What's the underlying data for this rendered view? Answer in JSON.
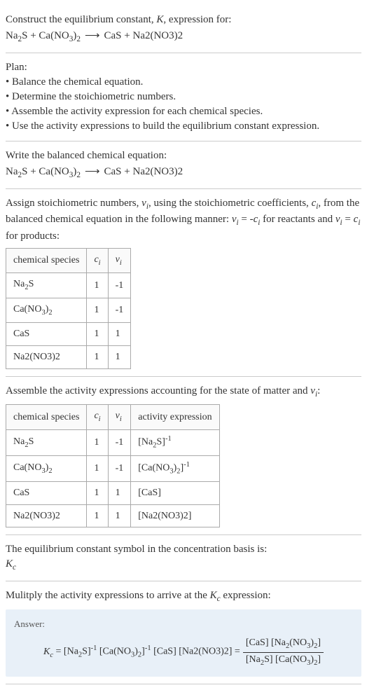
{
  "intro": {
    "line1": "Construct the equilibrium constant, K, expression for:",
    "equation": "Na₂S + Ca(NO₃)₂ ⟶ CaS + Na2(NO3)2"
  },
  "plan": {
    "heading": "Plan:",
    "items": [
      "Balance the chemical equation.",
      "Determine the stoichiometric numbers.",
      "Assemble the activity expression for each chemical species.",
      "Use the activity expressions to build the equilibrium constant expression."
    ]
  },
  "balanced": {
    "heading": "Write the balanced chemical equation:",
    "equation": "Na₂S + Ca(NO₃)₂ ⟶ CaS + Na2(NO3)2"
  },
  "stoich": {
    "text1": "Assign stoichiometric numbers, νᵢ, using the stoichiometric coefficients, cᵢ, from the balanced chemical equation in the following manner: νᵢ = -cᵢ for reactants and νᵢ = cᵢ for products:",
    "headers": [
      "chemical species",
      "cᵢ",
      "νᵢ"
    ],
    "rows": [
      {
        "species": "Na₂S",
        "c": "1",
        "v": "-1"
      },
      {
        "species": "Ca(NO₃)₂",
        "c": "1",
        "v": "-1"
      },
      {
        "species": "CaS",
        "c": "1",
        "v": "1"
      },
      {
        "species": "Na2(NO3)2",
        "c": "1",
        "v": "1"
      }
    ]
  },
  "activity": {
    "heading": "Assemble the activity expressions accounting for the state of matter and νᵢ:",
    "headers": [
      "chemical species",
      "cᵢ",
      "νᵢ",
      "activity expression"
    ],
    "rows": [
      {
        "species": "Na₂S",
        "c": "1",
        "v": "-1",
        "expr": "[Na₂S]⁻¹"
      },
      {
        "species": "Ca(NO₃)₂",
        "c": "1",
        "v": "-1",
        "expr": "[Ca(NO₃)₂]⁻¹"
      },
      {
        "species": "CaS",
        "c": "1",
        "v": "1",
        "expr": "[CaS]"
      },
      {
        "species": "Na2(NO3)2",
        "c": "1",
        "v": "1",
        "expr": "[Na2(NO3)2]"
      }
    ]
  },
  "symbol": {
    "line1": "The equilibrium constant symbol in the concentration basis is:",
    "line2": "K_c"
  },
  "multiply": {
    "heading": "Mulitply the activity expressions to arrive at the K_c expression:"
  },
  "answer": {
    "label": "Answer:",
    "lhs": "K_c = [Na₂S]⁻¹ [Ca(NO₃)₂]⁻¹ [CaS] [Na2(NO3)2] =",
    "num": "[CaS] [Na2(NO3)2]",
    "den": "[Na₂S] [Ca(NO₃)₂]"
  }
}
